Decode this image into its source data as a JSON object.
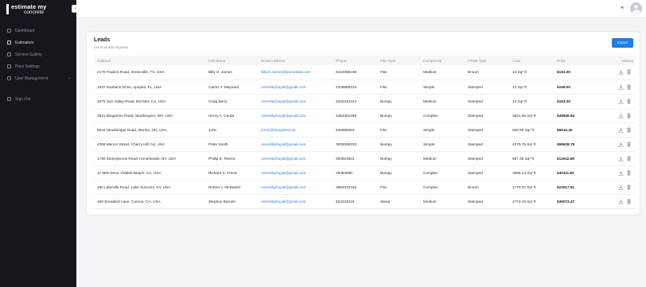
{
  "brand": {
    "line1": "estimate my",
    "line2": "concrete",
    "collapse_glyph": "‹"
  },
  "sidebar": {
    "items": [
      {
        "label": "Dashboard",
        "icon": "dashboard-icon",
        "active": false
      },
      {
        "label": "Estimators",
        "icon": "estimators-icon",
        "active": true
      },
      {
        "label": "Service Gallery",
        "icon": "gallery-icon",
        "active": false
      },
      {
        "label": "Price Settings",
        "icon": "price-settings-icon",
        "active": false
      },
      {
        "label": "User Management",
        "icon": "user-management-icon",
        "active": false,
        "chevron": "⌄"
      }
    ],
    "signout_label": "Sign Out"
  },
  "topbar": {
    "theme_icon": "sun-icon",
    "theme_glyph": "☀",
    "avatar_icon": "user-avatar-icon"
  },
  "leads": {
    "title": "Leads",
    "subtitle": "List of all lead requests",
    "export_label": "Export",
    "columns": [
      "Address",
      "Full Name",
      "Email Address",
      "Phone",
      "Flat Type",
      "Complexity",
      "Finish Type",
      "Area",
      "Price",
      "Actions"
    ],
    "area_unit": "Sq",
    "area_exp": "2",
    "area_suffix": "ft",
    "rows": [
      {
        "address": "2170 Traders Road, Greenville, TX, USA",
        "name": "Billy H. James",
        "email": "BillyH.James@journalida.com",
        "phone": "8163365189",
        "flat_type": "Flat",
        "complexity": "Medium",
        "finish": "Broom",
        "area": "12",
        "price": "$161.00"
      },
      {
        "address": "1637 Sunburst Drive, Apopka, FL, USA",
        "name": "Carlos Y. Maynard",
        "email": "umeshkphuyal@gmail.com",
        "phone": "2349889234",
        "flat_type": "Flat",
        "complexity": "Simple",
        "finish": "Stamped",
        "area": "12",
        "price": "$156.00"
      },
      {
        "address": "2078 Sun Valley Road, Del Mar, CA, USA",
        "name": "Craig Berry",
        "email": "umeshkphuyal@gmail.com",
        "phone": "2342342444",
        "flat_type": "Bumpy",
        "complexity": "Medium",
        "finish": "Stamped",
        "area": "12",
        "price": "$163.00"
      },
      {
        "address": "3631 Bingamon Road, Worthington, WV, USA",
        "name": "Henry A. Cerda",
        "email": "umeshkphuyal@gmail.com",
        "phone": "3452452455",
        "flat_type": "Bumpy",
        "complexity": "Complex",
        "finish": "Stamped",
        "area": "3841.68",
        "price": "$49946.84"
      },
      {
        "address": "8042 Stockbridge Road, Mentor, OH, USA",
        "name": "John",
        "email": "j7e11@xbcglobal.net",
        "phone": "545985564",
        "flat_type": "Flat",
        "complexity": "Simple",
        "finish": "Stamped",
        "area": "500.80",
        "price": "$6510.40"
      },
      {
        "address": "4369 Mercer Street, Cherry Hill, NJ, USA",
        "name": "Peter Smith",
        "email": "umeshkphuyal@gmail.com",
        "phone": "3939399333",
        "flat_type": "Bumpy",
        "complexity": "Simple",
        "finish": "Stamped",
        "area": "4279.75",
        "price": "$55638.75"
      },
      {
        "address": "1730 Stoneybrook Road, Horseheads, NY, USA",
        "name": "Phillip E. Rivera",
        "email": "umeshkphuyal@gmail.com",
        "phone": "283823822",
        "flat_type": "Bumpy",
        "complexity": "Medium",
        "finish": "Stamped",
        "area": "887.36",
        "price": "$11542.68"
      },
      {
        "address": "17 Mile Drive, Pebble Beach, CA, USA",
        "name": "Richard S. Freed",
        "email": "umeshkphuyal@gmail.com",
        "phone": "28383888",
        "flat_type": "Bumpy",
        "complexity": "Complex",
        "finish": "Stamped",
        "area": "3085.14",
        "price": "$40111.82"
      },
      {
        "address": "450 Lakeville Road, Lake Success, NY, USA",
        "name": "Robert J. McDaniel",
        "email": "umeshkphuyal@gmail.com",
        "phone": "3993332345",
        "flat_type": "Flat",
        "complexity": "Complex",
        "finish": "Broom",
        "area": "1770.37",
        "price": "$23017.81"
      },
      {
        "address": "468 Snowbird Lane, Corona, CA, USA",
        "name": "Stephen Barnett",
        "email": "umeshkphuyal@gmail.com",
        "phone": "823234234",
        "flat_type": "Steep",
        "complexity": "Medium",
        "finish": "Stamped",
        "area": "2774.19",
        "price": "$36072.47"
      }
    ],
    "row_actions": [
      "download-icon",
      "trash-icon"
    ]
  },
  "colors": {
    "sidebar_bg": "#16171c",
    "accent": "#1f7de8",
    "email_link": "#2f7fe0",
    "page_bg": "#f4f5f7"
  }
}
